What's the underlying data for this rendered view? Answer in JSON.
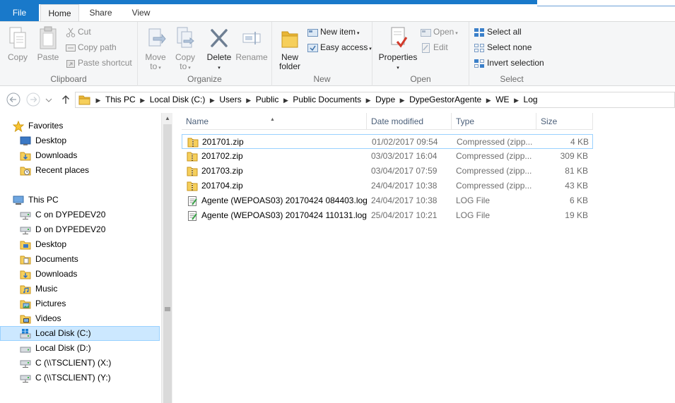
{
  "tabs": {
    "file": "File",
    "home": "Home",
    "share": "Share",
    "view": "View"
  },
  "ribbon": {
    "clipboard": {
      "label": "Clipboard",
      "copy": "Copy",
      "paste": "Paste",
      "cut": "Cut",
      "copy_path": "Copy path",
      "paste_shortcut": "Paste shortcut"
    },
    "organize": {
      "label": "Organize",
      "move_to": [
        "Move",
        "to"
      ],
      "copy_to": [
        "Copy",
        "to"
      ],
      "delete": "Delete",
      "rename": "Rename"
    },
    "new": {
      "label": "New",
      "new_folder": [
        "New",
        "folder"
      ],
      "new_item": "New item",
      "easy_access": "Easy access"
    },
    "open": {
      "label": "Open",
      "properties": "Properties",
      "open": "Open",
      "edit": "Edit"
    },
    "select": {
      "label": "Select",
      "select_all": "Select all",
      "select_none": "Select none",
      "invert_selection": "Invert selection"
    }
  },
  "address": {
    "crumbs": [
      "This PC",
      "Local Disk (C:)",
      "Users",
      "Public",
      "Public Documents",
      "Dype",
      "DypeGestorAgente",
      "WE",
      "Log"
    ]
  },
  "nav": {
    "favorites": "Favorites",
    "desktop": "Desktop",
    "downloads": "Downloads",
    "recent_places": "Recent places",
    "this_pc": "This PC",
    "c_on": "C on DYPEDEV20",
    "d_on": "D on DYPEDEV20",
    "pc_desktop": "Desktop",
    "documents": "Documents",
    "pc_downloads": "Downloads",
    "music": "Music",
    "pictures": "Pictures",
    "videos": "Videos",
    "local_c": "Local Disk (C:)",
    "local_d": "Local Disk (D:)",
    "ts_x": "C (\\\\TSCLIENT) (X:)",
    "ts_y": "C (\\\\TSCLIENT) (Y:)"
  },
  "columns": {
    "name": "Name",
    "date": "Date modified",
    "type": "Type",
    "size": "Size"
  },
  "files": [
    {
      "name": "201701.zip",
      "date": "01/02/2017 09:54",
      "type": "Compressed (zipp...",
      "size": "4 KB",
      "icon": "zip-folder-icon"
    },
    {
      "name": "201702.zip",
      "date": "03/03/2017 16:04",
      "type": "Compressed (zipp...",
      "size": "309 KB",
      "icon": "zip-folder-icon"
    },
    {
      "name": "201703.zip",
      "date": "03/04/2017 07:59",
      "type": "Compressed (zipp...",
      "size": "81 KB",
      "icon": "zip-folder-icon"
    },
    {
      "name": "201704.zip",
      "date": "24/04/2017 10:38",
      "type": "Compressed (zipp...",
      "size": "43 KB",
      "icon": "zip-folder-icon"
    },
    {
      "name": "Agente (WEPOAS03) 20170424 084403.log",
      "date": "24/04/2017 10:38",
      "type": "LOG File",
      "size": "6 KB",
      "icon": "log-file-icon"
    },
    {
      "name": "Agente (WEPOAS03) 20170424 110131.log",
      "date": "25/04/2017 10:21",
      "type": "LOG File",
      "size": "19 KB",
      "icon": "log-file-icon"
    }
  ]
}
